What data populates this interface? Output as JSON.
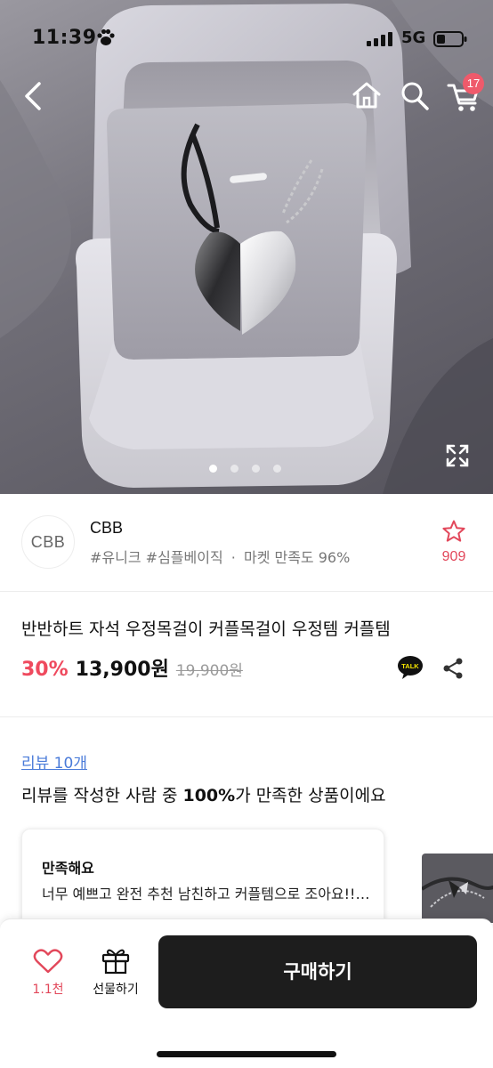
{
  "status_bar": {
    "time": "11:39",
    "network": "5G"
  },
  "nav": {
    "cart_count": "17"
  },
  "gallery": {
    "current": 1,
    "total": 4
  },
  "store": {
    "logo_text": "CBB",
    "name": "CBB",
    "tag1": "#유니크",
    "tag2": "#심플베이직",
    "separator": "·",
    "satisfaction": "마켓 만족도 96%",
    "favorites": "909"
  },
  "product": {
    "title": "반반하트 자석 우정목걸이 커플목걸이 우정템 커플템",
    "discount": "30%",
    "price": "13,900원",
    "original_price": "19,900원",
    "talk_label": "TALK"
  },
  "reviews": {
    "link": "리뷰 10개",
    "summary_prefix": "리뷰를 작성한 사람 중 ",
    "summary_percent": "100%",
    "summary_suffix": "가 만족한 상품이에요",
    "card": {
      "title": "만족해요",
      "text": "너무 예쁘고 완전 추천 남친하고 커플템으로 조아요!!…"
    }
  },
  "bottom_bar": {
    "likes": "1.1천",
    "gift_label": "선물하기",
    "buy_label": "구매하기"
  },
  "colors": {
    "accent": "#ef4a5e",
    "link": "#4a7bd9",
    "buy_button": "#1d1d1d",
    "badge": "#ef5a6b"
  }
}
